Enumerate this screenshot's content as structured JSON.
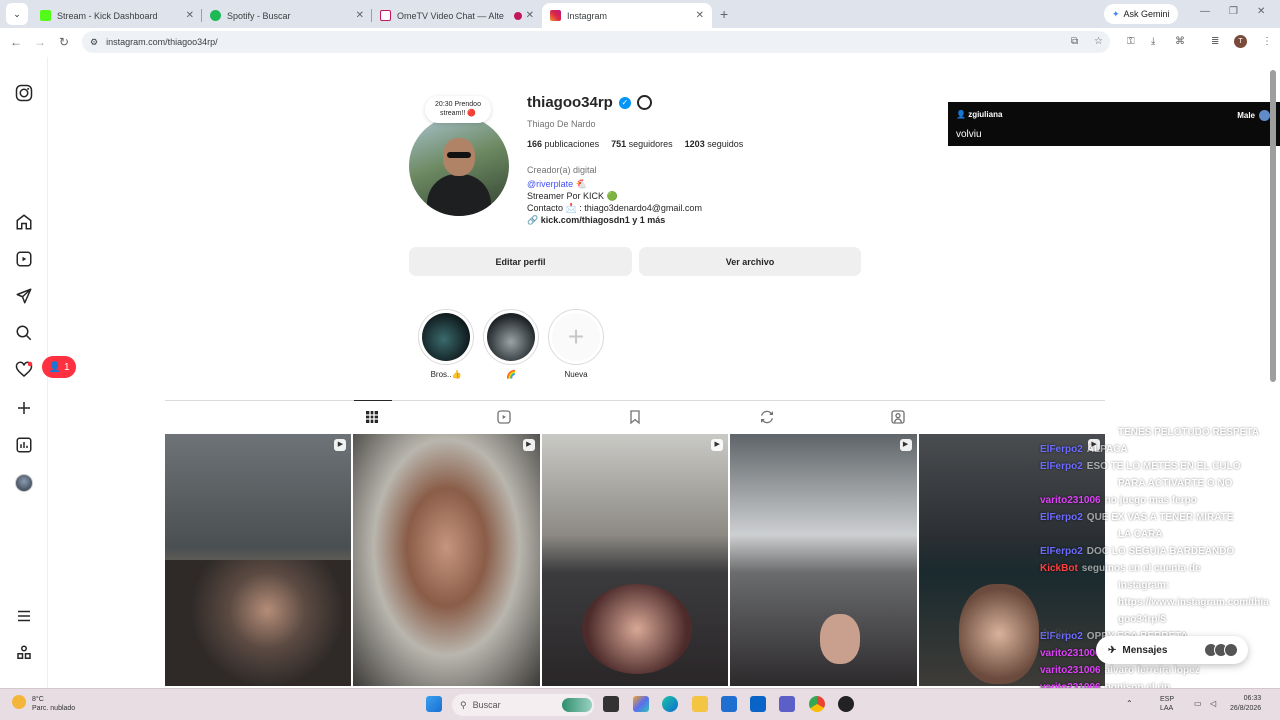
{
  "browser": {
    "tabs": [
      {
        "title": "Stream - Kick Dashboard",
        "favicon_color": "#53fc18"
      },
      {
        "title": "Spotify - Buscar",
        "favicon_color": "#1db954"
      },
      {
        "title": "OmeTV Video Chat — Alte",
        "favicon_color": "#c2185b"
      },
      {
        "title": "Instagram",
        "favicon_color": "#e1306c"
      }
    ],
    "gemini_label": "Ask Gemini",
    "url": "instagram.com/thiagoo34rp/"
  },
  "sidebar": {
    "notification_count": "1"
  },
  "profile": {
    "note": "20:30 Prendoo stream!! 🔴",
    "username": "thiagoo34rp",
    "verified_mark": "✓",
    "full_name": "Thiago De Nardo",
    "stats": {
      "posts_count": "166",
      "posts_label": "publicaciones",
      "followers_count": "751",
      "followers_label": "seguidores",
      "following_count": "1203",
      "following_label": "seguidos"
    },
    "bio": {
      "category": "Creador(a) digital",
      "mention": "@riverplate 🐔",
      "line1": "Streamer Por KICK 🟢",
      "line2": "Contacto 📩 : thiago3denardo4@gmail.com",
      "link": "kick.com/thiagosdn1 y 1 más"
    },
    "edit_button": "Editar perfil",
    "archive_button": "Ver archivo",
    "highlights": [
      {
        "label": "Bros..👍"
      },
      {
        "label": "🌈"
      },
      {
        "label": "Nueva",
        "plus": "+"
      }
    ]
  },
  "ometv": {
    "username": "zgiuliana",
    "gender": "Male",
    "message": "volviu"
  },
  "chat": [
    {
      "user": "",
      "user_color": "#ffffff",
      "msg": "TENES PELOTUDO RESPETA"
    },
    {
      "user": "ElFerpo2",
      "user_color": "#6c6cff",
      "msg": "ALPACA"
    },
    {
      "user": "ElFerpo2",
      "user_color": "#6c6cff",
      "msg": "ESO TE LO METES EN EL CULO"
    },
    {
      "user": "",
      "user_color": "#ffffff",
      "msg": "PARA ACTIVARTE O NO"
    },
    {
      "user": "varito231006",
      "user_color": "#e040fb",
      "msg": "no juego mas ferpo"
    },
    {
      "user": "ElFerpo2",
      "user_color": "#6c6cff",
      "msg": "QUE EX VAS A TENER MIRATE"
    },
    {
      "user": "",
      "user_color": "#ffffff",
      "msg": "LA CARA"
    },
    {
      "user": "ElFerpo2",
      "user_color": "#6c6cff",
      "msg": "DOC LO SEGUIA BARDEANDO"
    },
    {
      "user": "KickBot",
      "user_color": "#ff4040",
      "msg": "seguinos en el cuenta de"
    },
    {
      "user": "",
      "user_color": "#ffffff",
      "msg": "instagram:"
    },
    {
      "user": "",
      "user_color": "#ffffff",
      "msg": "https://www.instagram.com/thia"
    },
    {
      "user": "",
      "user_color": "#ffffff",
      "msg": "goo34rp/$"
    },
    {
      "user": "ElFerpo2",
      "user_color": "#6c6cff",
      "msg": "OPPY ESA BERRETA"
    },
    {
      "user": "varito231006",
      "user_color": "#e040fb",
      "msg": "alvaro dixon"
    },
    {
      "user": "varito231006",
      "user_color": "#e040fb",
      "msg": "alvaro ferreira lopez"
    },
    {
      "user": "varito231006",
      "user_color": "#e040fb",
      "msg": "ponison el rip"
    },
    {
      "user": "zgiuliana",
      "user_color": "#e040fb",
      "msg": "volviu"
    }
  ],
  "overlay": {
    "activate_text": "Activ",
    "messages_label": "Mensajes"
  },
  "taskbar": {
    "temperature": "8°C",
    "weather": "Parc. nublado",
    "search_placeholder": "Buscar",
    "lang": "ESP",
    "lang_sub": "LAA",
    "time": "06:33",
    "date": "26/8/2026"
  }
}
